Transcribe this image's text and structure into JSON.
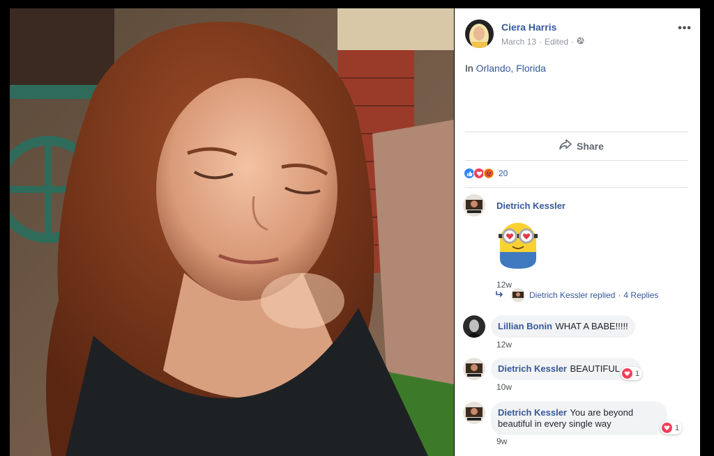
{
  "post": {
    "author": "Ciera Harris",
    "date": "March 13",
    "edited": "Edited",
    "separator": "·",
    "more_label": "•••",
    "location_prefix": "In",
    "location_name": "Orlando, Florida"
  },
  "actions": {
    "share_label": "Share"
  },
  "reactions": {
    "count": "20"
  },
  "comments": [
    {
      "author": "Dietrich Kessler",
      "text": "",
      "time": "12w",
      "sticker": "minion-heart-eyes"
    },
    {
      "author": "Lillian Bonin",
      "text": "WHAT A BABE!!!!!",
      "time": "12w"
    },
    {
      "author": "Dietrich Kessler",
      "text": "BEAUTIFUL",
      "time": "10w",
      "reaction_count": "1"
    },
    {
      "author": "Dietrich Kessler",
      "text": "You are beyond beautiful in every single way",
      "time": "9w",
      "reaction_count": "1"
    }
  ],
  "replies": {
    "text": "Dietrich Kessler replied",
    "separator": "·",
    "count": "4 Replies"
  },
  "colors": {
    "link": "#365899",
    "bubble": "#f2f3f5",
    "love": "#f33e58"
  }
}
